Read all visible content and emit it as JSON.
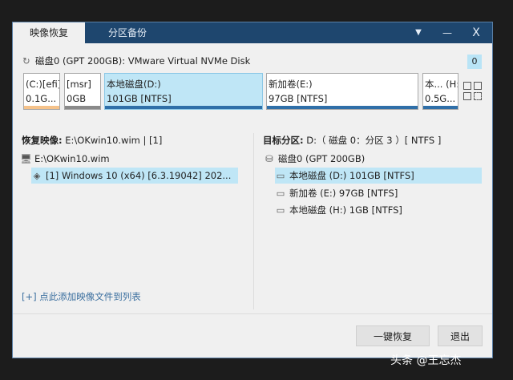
{
  "tabs": {
    "active": "映像恢复",
    "inactive": "分区备份"
  },
  "titlebar": {
    "menu_icon": "▼",
    "minimize_icon": "—",
    "close_icon": "X"
  },
  "disk": {
    "label": "磁盘0 (GPT 200GB): VMware Virtual NVMe Disk",
    "counter": "0"
  },
  "partitions": [
    {
      "name": "(C:)[efi]",
      "size": "0.1G...",
      "bar_color": "#f5c28a",
      "selected": false
    },
    {
      "name": "[msr]",
      "size": "0GB",
      "bar_color": "#8a8a8a",
      "selected": false
    },
    {
      "name": "本地磁盘(D:)",
      "size": "101GB [NTFS]",
      "bar_color": "#2f6fa8",
      "selected": true
    },
    {
      "name": "新加卷(E:)",
      "size": "97GB [NTFS]",
      "bar_color": "#2f6fa8",
      "selected": false
    },
    {
      "name": "本... (H:)",
      "size": "0.5G...",
      "bar_color": "#2f6fa8",
      "selected": false
    }
  ],
  "left_panel": {
    "label_bold": "恢复映像:",
    "label_value": "E:\\OKwin10.wim | [1]",
    "root_item": "E:\\OKwin10.wim",
    "child_item": "[1] Windows 10 (x64) [6.3.19042] 202..."
  },
  "right_panel": {
    "label_bold": "目标分区:",
    "label_value": "D:（ 磁盘 0：分区 3 ）[ NTFS ]",
    "disk_item": "磁盘0 (GPT 200GB)",
    "items": [
      "本地磁盘 (D:) 101GB [NTFS]",
      "新加卷 (E:) 97GB [NTFS]",
      "本地磁盘 (H:) 1GB [NTFS]"
    ]
  },
  "add_link": "[+] 点此添加映像文件到列表",
  "buttons": {
    "restore": "一键恢复",
    "exit": "退出"
  },
  "watermark": "头条 @王忘杰"
}
